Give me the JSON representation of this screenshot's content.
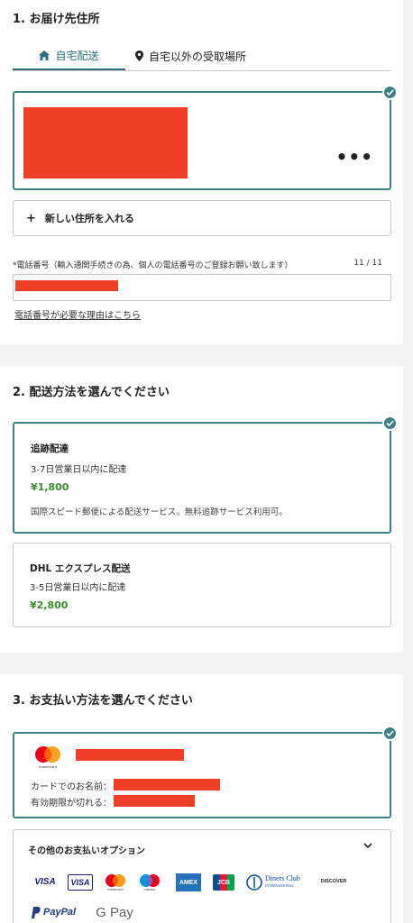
{
  "address": {
    "title": "1. お届け先住所",
    "tabs": [
      {
        "label": "自宅配送",
        "icon": "home-icon",
        "active": true
      },
      {
        "label": "自宅以外の受取場所",
        "icon": "location-pin-icon",
        "active": false
      }
    ],
    "more_icon": "•••",
    "add_address_label": "新しい住所を入れる",
    "phone_label": "*電話番号（輸入通関手続きの為、個人の電話番号のご登録お願い致します）",
    "phone_count": "11 / 11",
    "phone_reason_link": "電話番号が必要な理由はこちら"
  },
  "shipping": {
    "title": "2. 配送方法を選んでください",
    "options": [
      {
        "name": "追跡配達",
        "days": "3-7日営業日以内に配達",
        "price": "¥1,800",
        "desc": "国際スピード郵便による配送サービス。無料追跡サービス利用可。",
        "selected": true
      },
      {
        "name": "DHL エクスプレス配送",
        "days": "3-5日営業日以内に配達",
        "price": "¥2,800",
        "desc": "",
        "selected": false
      }
    ]
  },
  "payment": {
    "title": "3. お支払い方法を選んでください",
    "card_brand": "mastercard",
    "name_label": "カードでのお名前：",
    "expiry_label": "有効期限が切れる：",
    "other_options_label": "その他のお支払いオプション",
    "logos": [
      "VISA",
      "VISA",
      "mastercard",
      "maestro",
      "AMEX",
      "JCB",
      "Diners Club",
      "DISCOVER",
      "PayPal",
      "G Pay"
    ],
    "diners_sub": "INTERNATIONAL"
  },
  "colors": {
    "accent": "#3f7f88",
    "price_green": "#3a8a2e",
    "redaction": "#ef3f27"
  }
}
